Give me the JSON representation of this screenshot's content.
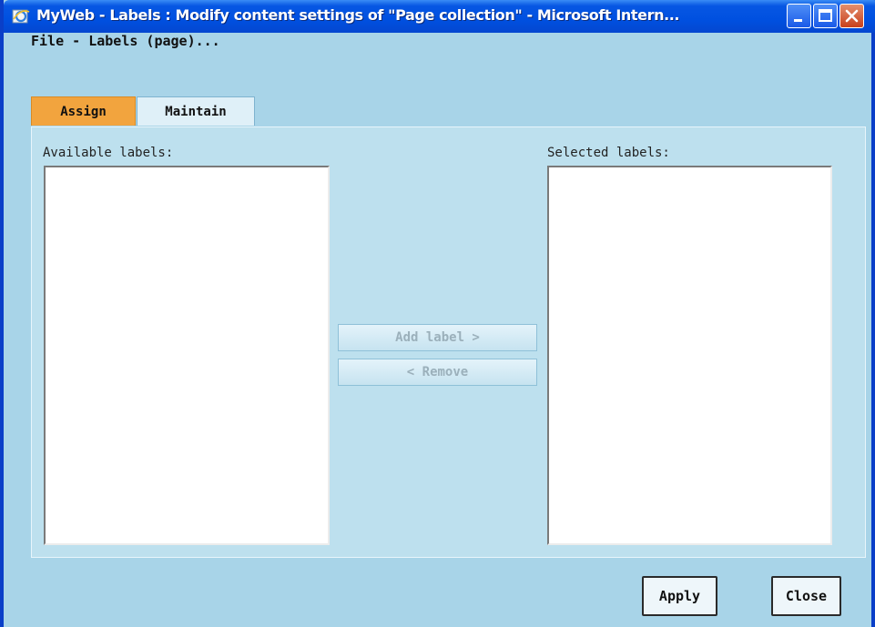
{
  "window": {
    "title": "MyWeb - Labels : Modify content settings of \"Page collection\" - Microsoft Intern...",
    "controls": [
      "minimize-icon",
      "maximize-icon",
      "close-icon"
    ],
    "app_icon": "ie-icon"
  },
  "breadcrumb": "File - Labels (page)...",
  "tabs": [
    {
      "label": "Assign",
      "active": true
    },
    {
      "label": "Maintain",
      "active": false
    }
  ],
  "available": {
    "label": "Available labels:",
    "items": []
  },
  "selected": {
    "label": "Selected labels:",
    "items": []
  },
  "buttons": {
    "add": "Add label >",
    "remove": "< Remove",
    "apply": "Apply",
    "close": "Close"
  },
  "colors": {
    "titlebar": "#0050e0",
    "background": "#a8d4e8",
    "panel": "#bde0ee",
    "active_tab": "#f2a43e",
    "disabled_text": "#9bb0bb"
  }
}
